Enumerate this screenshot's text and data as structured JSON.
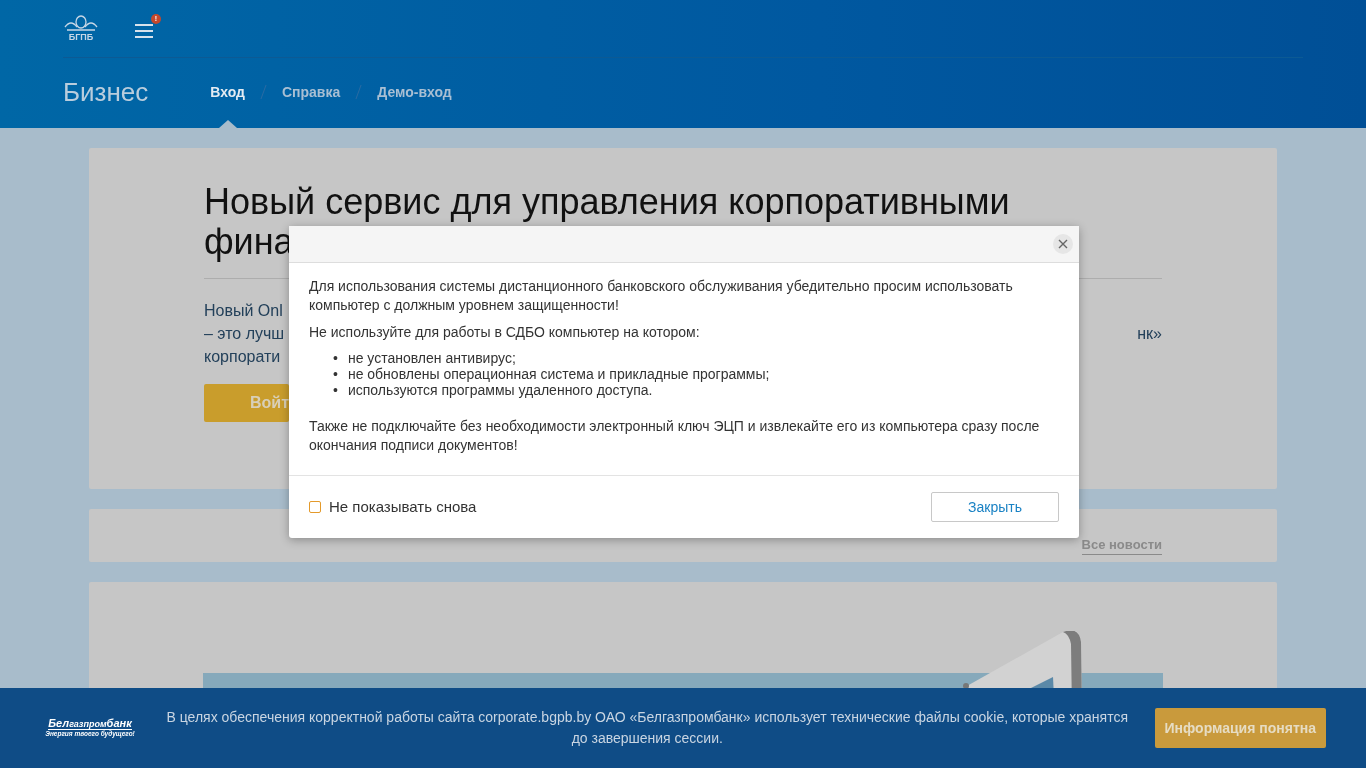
{
  "header": {
    "logo_text": "БГПБ",
    "menu_badge": "!",
    "section_title": "Бизнес",
    "tabs": [
      {
        "label": "Вход",
        "selected": true
      },
      {
        "label": "Справка",
        "selected": false
      },
      {
        "label": "Демо-вход",
        "selected": false
      }
    ]
  },
  "intro_card": {
    "heading_lines": [
      "Новый сервис для управления корпоративными",
      "фина"
    ],
    "text_lines": [
      {
        "left": "Новый Onl"
      },
      {
        "left": "– это лучш",
        "right": "нк»"
      },
      {
        "left": "корпорати"
      }
    ],
    "button": "Войт"
  },
  "news_card": {
    "link": "Все новости"
  },
  "modal": {
    "paragraphs": [
      "Для использования системы дистанционного банковского обслуживания убедительно просим использовать компьютер с должным уровнем защищенности!",
      "Не используйте для работы в СДБО компьютер на котором:"
    ],
    "list_marker": "•",
    "list": [
      "не установлен антивирус;",
      "не обновлены операционная система и прикладные программы;",
      "используются программы удаленного доступа."
    ],
    "closing": "Также не подключайте без необходимости электронный ключ ЭЦП и извлекайте его из компьютера сразу после окончания подписи документов!",
    "dont_show": {
      "label": "Не показывать снова",
      "checked": false
    },
    "close_button": "Закрыть"
  },
  "cookie_bar": {
    "logo": {
      "name_parts": [
        "Бел",
        "газпром",
        "банк"
      ],
      "tagline": "Энергия твоего будущего!"
    },
    "text": "В целях обеспечения корректной работы сайта corporate.bgpb.by ОАО «Белгазпромбанк» использует технические файлы cookie, которые хранятся до завершения сессии.",
    "button": "Информация понятна"
  }
}
